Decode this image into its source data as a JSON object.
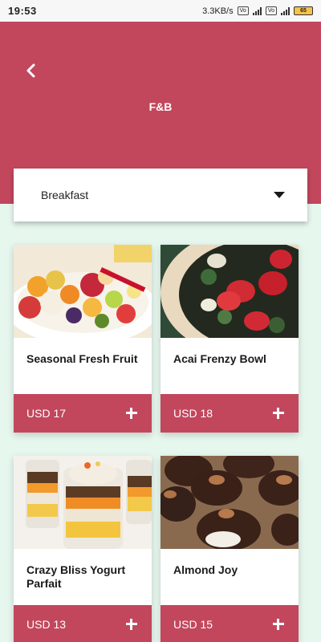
{
  "status_bar": {
    "time": "19:53",
    "network_speed": "3.3KB/s",
    "battery_level": "65"
  },
  "header": {
    "title": "F&B",
    "background_color": "#c2475d"
  },
  "category_dropdown": {
    "selected": "Breakfast"
  },
  "menu_items": [
    {
      "name": "Seasonal Fresh Fruit",
      "price": "USD 17",
      "image_icon": "fruit-salad-image"
    },
    {
      "name": "Acai Frenzy Bowl",
      "price": "USD 18",
      "image_icon": "acai-bowl-image"
    },
    {
      "name": "Crazy Bliss Yogurt Parfait",
      "price": "USD 13",
      "image_icon": "yogurt-parfait-image"
    },
    {
      "name": "Almond Joy",
      "price": "USD 15",
      "image_icon": "almond-joy-image"
    }
  ],
  "colors": {
    "accent": "#c2475d",
    "page_background": "#e6f7ee"
  }
}
